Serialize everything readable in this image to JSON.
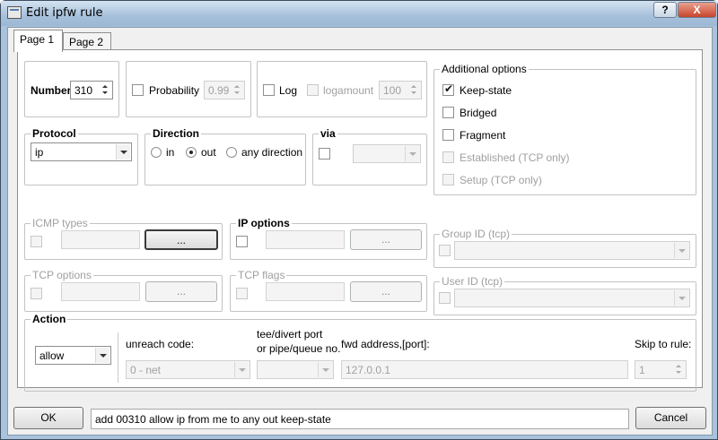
{
  "window": {
    "title": "Edit ipfw rule",
    "help_label": "?",
    "close_label": "X"
  },
  "tabs": [
    {
      "label": "Page 1"
    },
    {
      "label": "Page 2"
    }
  ],
  "number": {
    "label": "Number",
    "value": "310"
  },
  "probability": {
    "label": "Probability",
    "value": "0.99"
  },
  "log": {
    "label": "Log",
    "logamount_label": "logamount",
    "logamount_value": "100"
  },
  "protocol": {
    "caption": "Protocol",
    "value": "ip"
  },
  "direction": {
    "caption": "Direction",
    "options": [
      "in",
      "out",
      "any direction"
    ],
    "selected": "out"
  },
  "via": {
    "caption": "via",
    "value": ""
  },
  "icmp": {
    "caption": "ICMP types",
    "button": "..."
  },
  "ip_options": {
    "caption": "IP options",
    "button": "..."
  },
  "tcp_options": {
    "caption": "TCP options",
    "button": "..."
  },
  "tcp_flags": {
    "caption": "TCP flags",
    "button": "..."
  },
  "additional": {
    "caption": "Additional options",
    "items": [
      {
        "label": "Keep-state",
        "checked": true,
        "enabled": true
      },
      {
        "label": "Bridged",
        "checked": false,
        "enabled": true
      },
      {
        "label": "Fragment",
        "checked": false,
        "enabled": true
      },
      {
        "label": "Established (TCP only)",
        "checked": false,
        "enabled": false
      },
      {
        "label": "Setup (TCP only)",
        "checked": false,
        "enabled": false
      }
    ]
  },
  "group_id": {
    "caption": "Group ID (tcp)"
  },
  "user_id": {
    "caption": "User ID (tcp)"
  },
  "action": {
    "caption": "Action",
    "value": "allow",
    "unreach_label": "unreach code:",
    "unreach_value": "0 - net",
    "tee_label_1": "tee/divert port",
    "tee_label_2": "or pipe/queue no.",
    "fwd_label": "fwd address,[port]:",
    "fwd_value": "127.0.0.1",
    "skip_label": "Skip to rule:",
    "skip_value": "1"
  },
  "footer": {
    "ok_label": "OK",
    "rule_text": "add 00310 allow ip from me to any out keep-state",
    "cancel_label": "Cancel"
  }
}
